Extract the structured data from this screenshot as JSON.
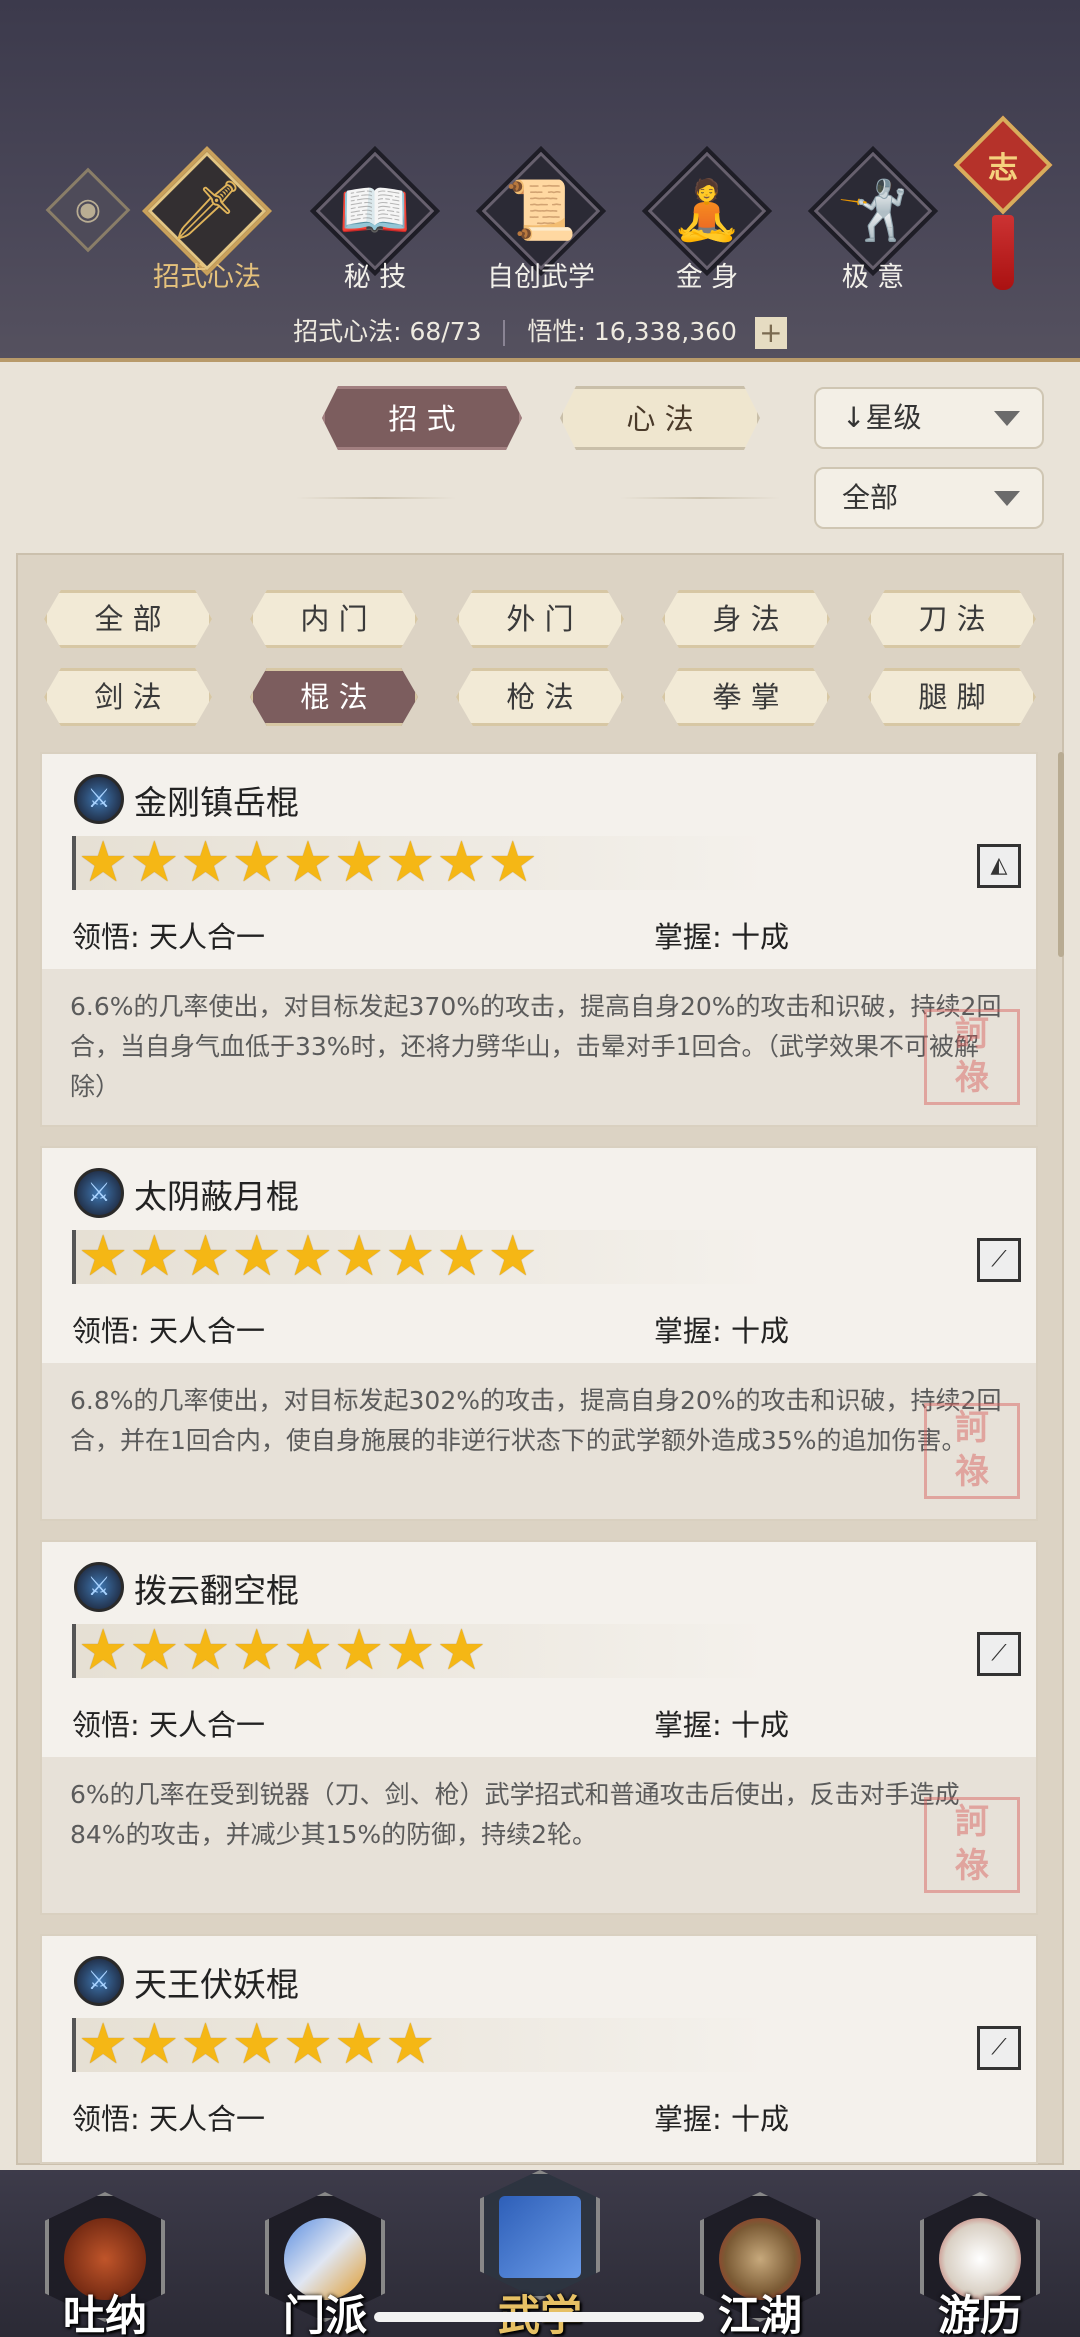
{
  "header": {
    "tabs": [
      {
        "label": "招式心法",
        "icon": "sword-icon",
        "glyph": "🗡",
        "active": true
      },
      {
        "label": "秘 技",
        "icon": "book-icon",
        "glyph": "📖",
        "active": false
      },
      {
        "label": "自创武学",
        "icon": "scroll-icon",
        "glyph": "📜",
        "active": false
      },
      {
        "label": "金 身",
        "icon": "meditation-icon",
        "glyph": "🧘",
        "active": false
      },
      {
        "label": "极 意",
        "icon": "martial-pose-icon",
        "glyph": "🤺",
        "active": false
      }
    ],
    "eye_glyph": "◉",
    "zhi_label": "志",
    "stats": {
      "skills_label": "招式心法:",
      "skills_value": "68/73",
      "insight_label": "悟性:",
      "insight_value": "16,338,360",
      "plus": "+"
    }
  },
  "filters": {
    "segments": [
      {
        "label": "招 式",
        "active": true
      },
      {
        "label": "心 法",
        "active": false
      }
    ],
    "sort_label": "↓星级",
    "scope_label": "全部",
    "categories_row1": [
      {
        "label": "全 部",
        "active": false
      },
      {
        "label": "内 门",
        "active": false
      },
      {
        "label": "外 门",
        "active": false
      },
      {
        "label": "身 法",
        "active": false
      },
      {
        "label": "刀 法",
        "active": false
      }
    ],
    "categories_row2": [
      {
        "label": "剑 法",
        "active": false
      },
      {
        "label": "棍 法",
        "active": true
      },
      {
        "label": "枪 法",
        "active": false
      },
      {
        "label": "拳 掌",
        "active": false
      },
      {
        "label": "腿 脚",
        "active": false
      }
    ]
  },
  "skills": [
    {
      "name": "金刚镇岳棍",
      "stars": 9,
      "star_text": "★★★★★★★★★",
      "badge": "◭",
      "comprehension_label": "领悟:",
      "comprehension": "天人合一",
      "mastery_label": "掌握:",
      "mastery": "十成",
      "description": "6.6%的几率使出，对目标发起370%的攻击，提高自身20%的攻击和识破，持续2回合，当自身气血低于33%时，还将力劈华山，击晕对手1回合。（武学效果不可被解除）",
      "seal": "訶\n祿"
    },
    {
      "name": "太阴蔽月棍",
      "stars": 9,
      "star_text": "★★★★★★★★★",
      "badge": "⟋",
      "comprehension_label": "领悟:",
      "comprehension": "天人合一",
      "mastery_label": "掌握:",
      "mastery": "十成",
      "description": "6.8%的几率使出，对目标发起302%的攻击，提高自身20%的攻击和识破，持续2回合，并在1回合内，使自身施展的非逆行状态下的武学额外造成35%的追加伤害。",
      "seal": "訶\n祿"
    },
    {
      "name": "拨云翻空棍",
      "stars": 8,
      "star_text": "★★★★★★★★",
      "badge": "⟋",
      "comprehension_label": "领悟:",
      "comprehension": "天人合一",
      "mastery_label": "掌握:",
      "mastery": "十成",
      "description": "6%的几率在受到锐器（刀、剑、枪）武学招式和普通攻击后使出，反击对手造成84%的攻击，并减少其15%的防御，持续2轮。",
      "seal": "訶\n祿"
    },
    {
      "name": "天王伏妖棍",
      "stars": 7,
      "star_text": "★★★★★★★",
      "badge": "⟋",
      "comprehension_label": "领悟:",
      "comprehension": "天人合一",
      "mastery_label": "掌握:",
      "mastery": "十成"
    }
  ],
  "bottom_nav": [
    {
      "label": "吐纳",
      "icon": "monk-icon",
      "active": false
    },
    {
      "label": "门派",
      "icon": "sect-emblem-icon",
      "active": false
    },
    {
      "label": "武学",
      "icon": "martial-book-icon",
      "active": true
    },
    {
      "label": "江湖",
      "icon": "straw-hat-icon",
      "active": false
    },
    {
      "label": "游历",
      "icon": "horse-icon",
      "active": false
    }
  ],
  "colors": {
    "header_bg": "#4a4758",
    "active_chip": "#7c5d5e",
    "star": "#f5b715",
    "gold": "#e5c27c"
  }
}
